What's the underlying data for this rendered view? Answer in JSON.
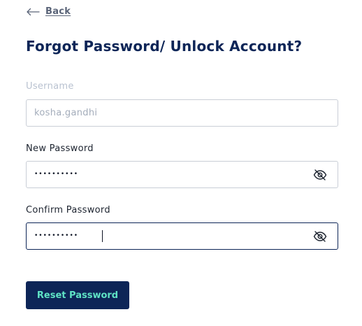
{
  "back": {
    "label": "Back"
  },
  "title": "Forgot Password/ Unlock Account?",
  "form": {
    "username": {
      "label": "Username",
      "value": "kosha.gandhi"
    },
    "new_password": {
      "label": "New Password",
      "masked_value": "••••••••••"
    },
    "confirm_password": {
      "label": "Confirm Password",
      "masked_value": "••••••••••"
    }
  },
  "submit_label": "Reset Password",
  "colors": {
    "navy": "#0d2557",
    "accent": "#5fe3c5",
    "border": "#c9ced6"
  }
}
